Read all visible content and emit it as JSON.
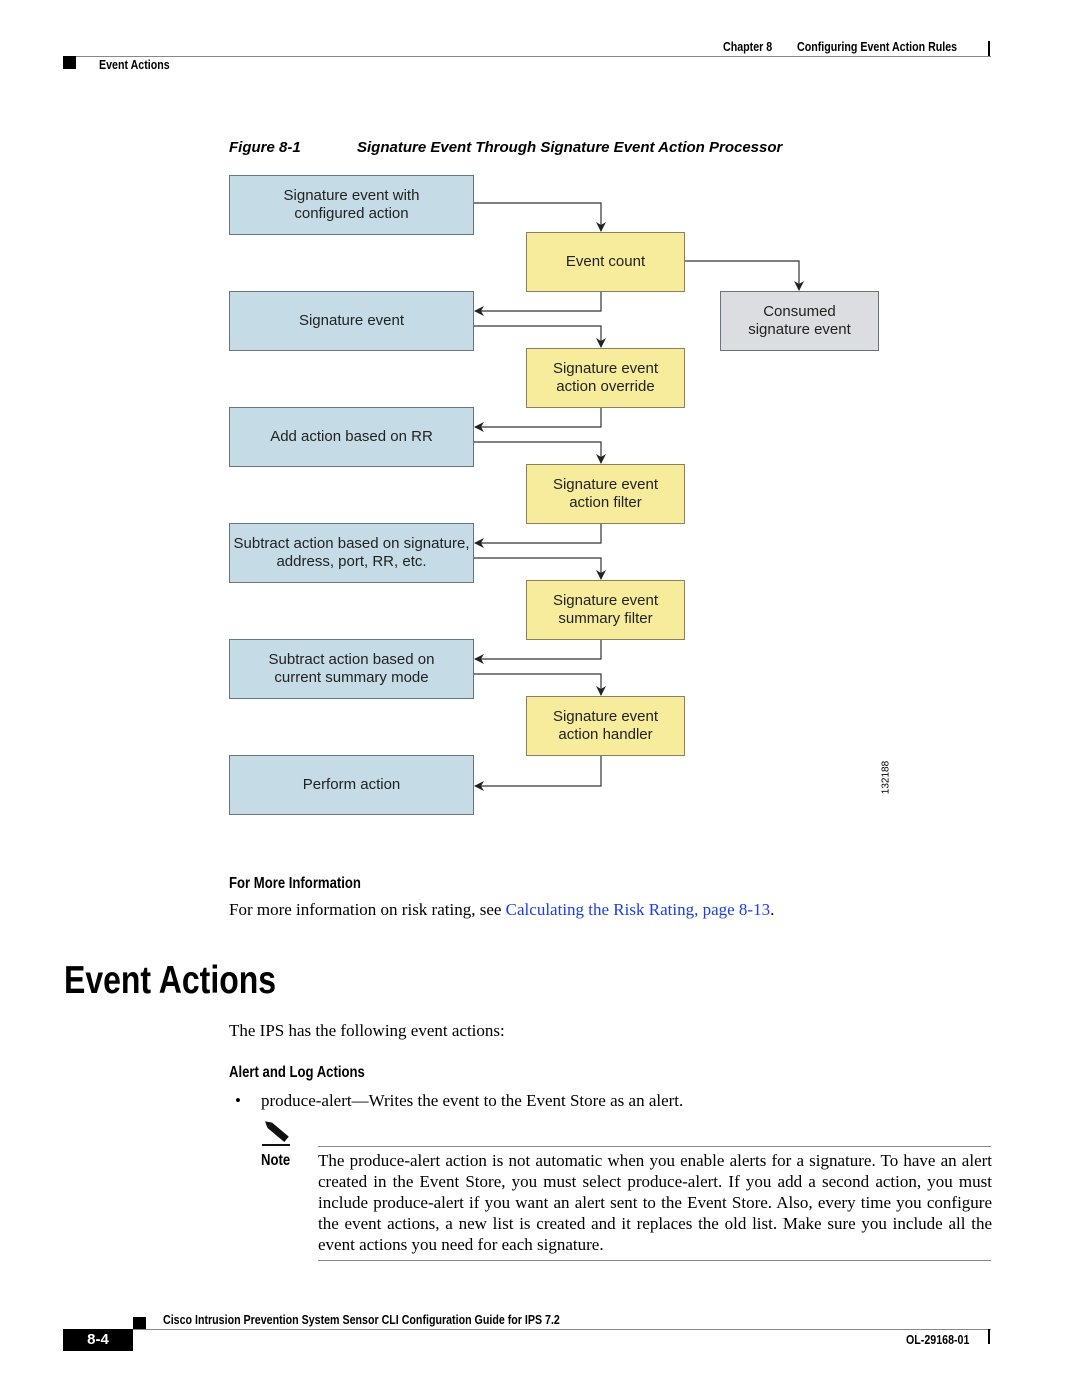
{
  "header": {
    "chapter": "Chapter 8",
    "chapter_title": "Configuring Event Action Rules",
    "section": "Event Actions"
  },
  "figure": {
    "number": "Figure 8-1",
    "title": "Signature Event Through Signature Event Action Processor",
    "left_boxes": [
      "Signature event with configured action",
      "Signature event",
      "Add action based on RR",
      "Subtract action based on signature, address, port, RR, etc.",
      "Subtract action based on current summary mode",
      "Perform action"
    ],
    "process_boxes": [
      "Event count",
      "Signature event action override",
      "Signature event action filter",
      "Signature event summary filter",
      "Signature event action handler"
    ],
    "consumed_box": "Consumed signature event",
    "figure_id": "132188",
    "colors": {
      "input": "#c5dbe5",
      "process": "#f7ec9c",
      "consumed": "#dcdde0"
    }
  },
  "more_info": {
    "heading": "For More Information",
    "text_before": "For more information on risk rating, see ",
    "link": "Calculating the Risk Rating, page 8-13",
    "text_after": "."
  },
  "section": {
    "title": "Event Actions",
    "intro": "The IPS has the following event actions:",
    "subheading": "Alert and Log Actions",
    "bullets": [
      "produce-alert—Writes the event to the Event Store as an alert."
    ]
  },
  "note": {
    "icon": "pencil-icon",
    "label": "Note",
    "text": "The produce-alert action is not automatic when you enable alerts for a signature. To have an alert created in the Event Store, you must select produce-alert. If you add a second action, you must include produce-alert if you want an alert sent to the Event Store. Also, every time you configure the event actions, a new list is created and it replaces the old list. Make sure you include all the event actions you need for each signature."
  },
  "footer": {
    "guide_title": "Cisco Intrusion Prevention System Sensor CLI Configuration Guide for IPS 7.2",
    "page_number": "8-4",
    "doc_number": "OL-29168-01"
  }
}
